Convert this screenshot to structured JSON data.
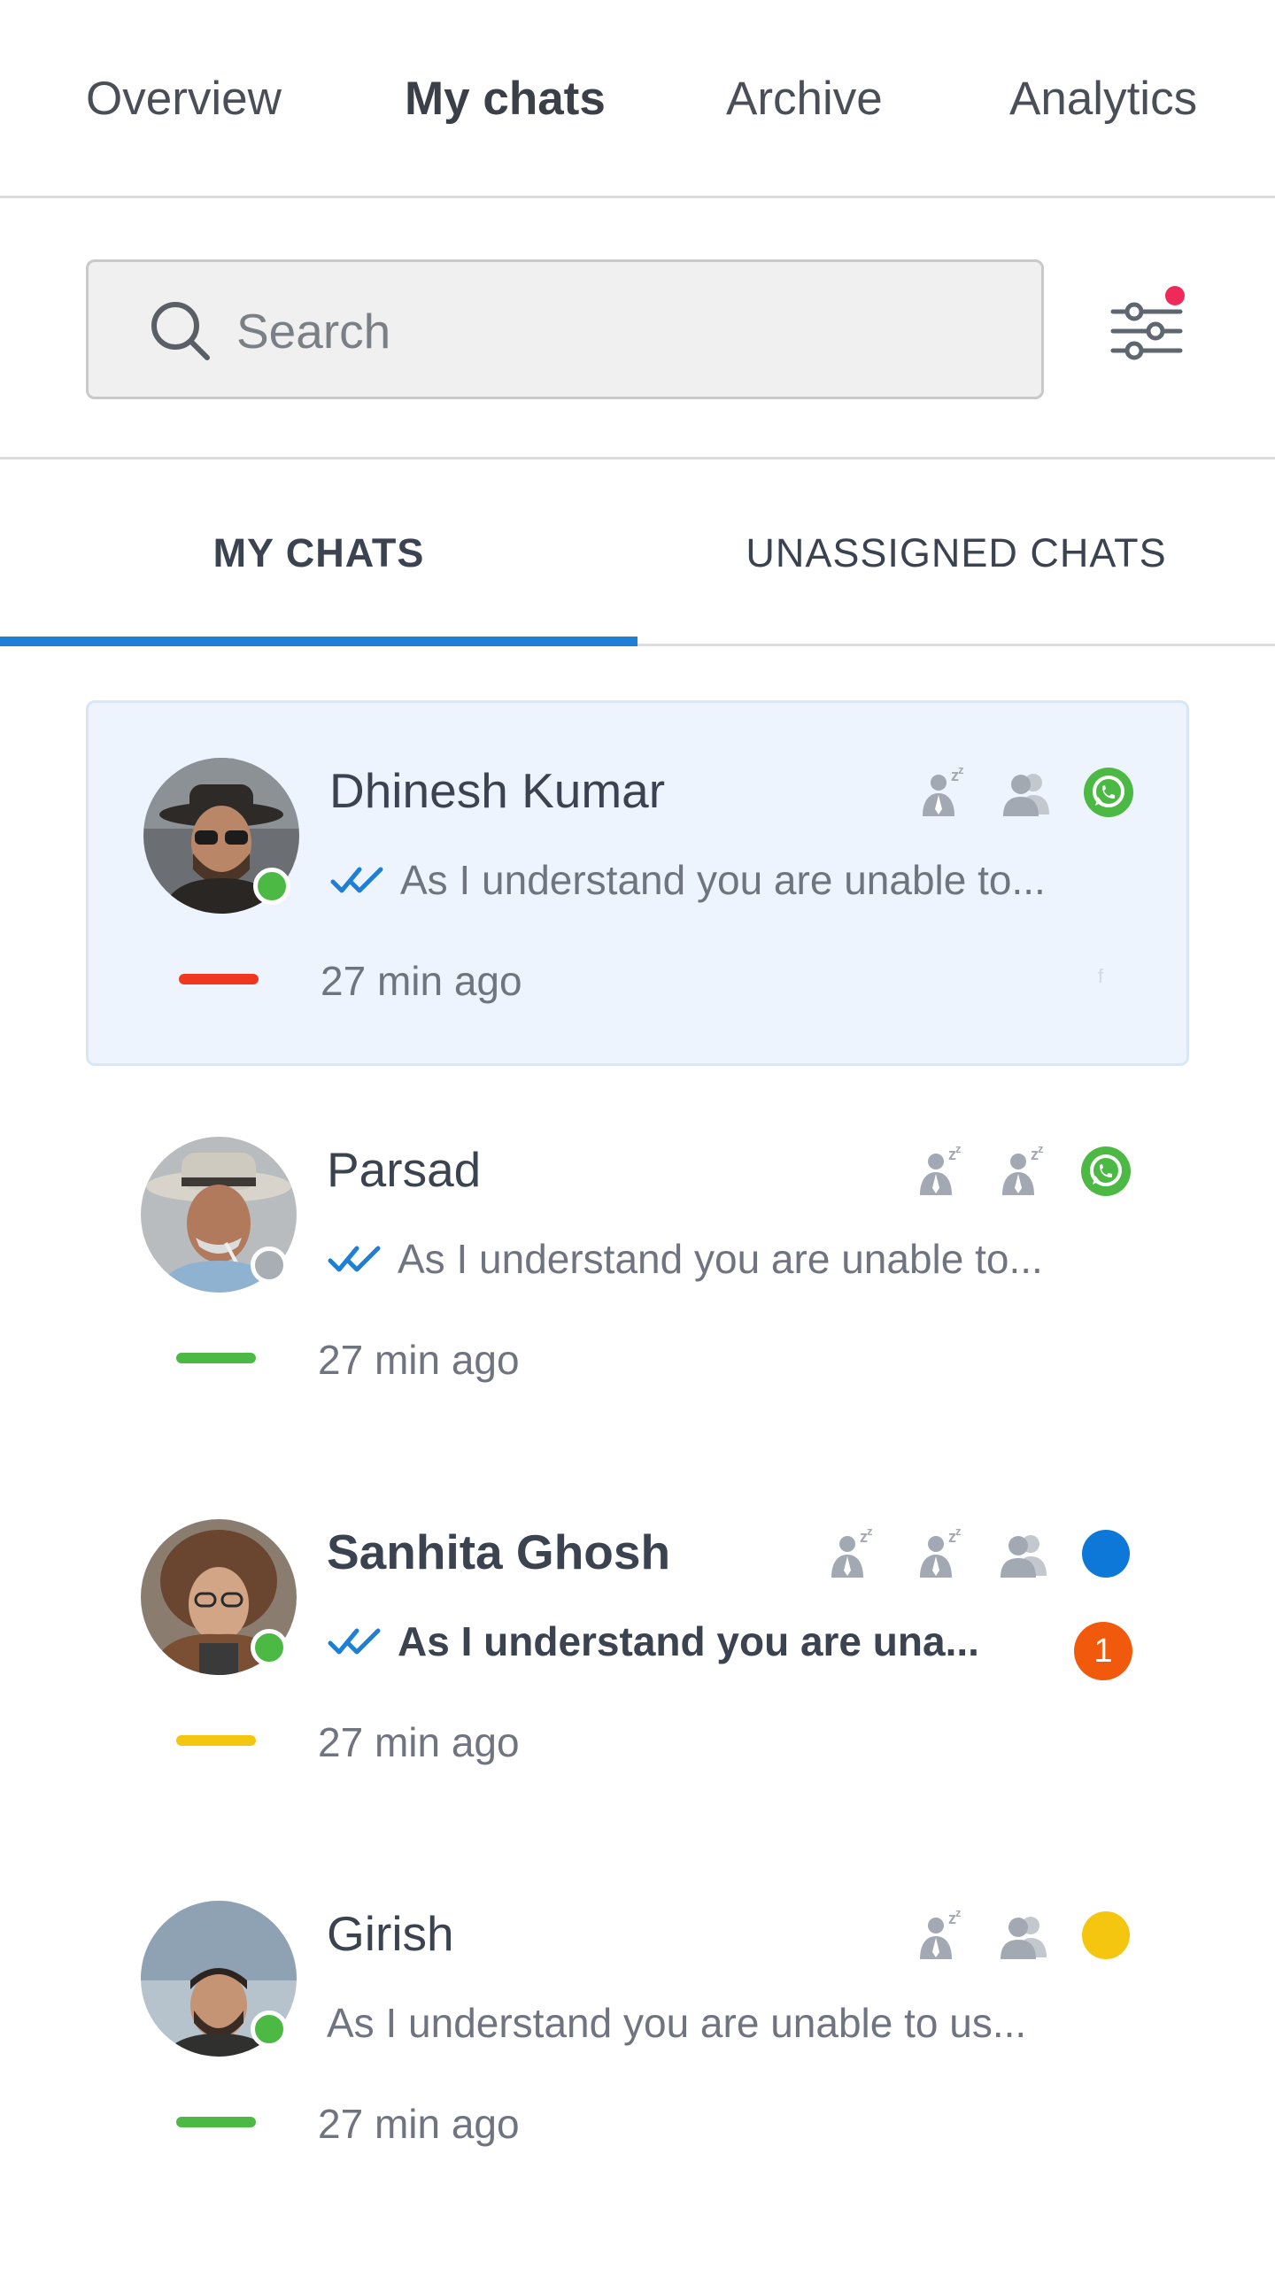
{
  "nav": {
    "items": [
      "Overview",
      "My chats",
      "Archive",
      "Analytics"
    ],
    "active": "My chats"
  },
  "search": {
    "placeholder": "Search"
  },
  "filter": {
    "icon": "sliders-icon",
    "has_notification_dot": true,
    "dot_color": "#ee2a5a"
  },
  "tabs": {
    "items": [
      "MY CHATS",
      "UNASSIGNED CHATS"
    ],
    "active": "MY CHATS",
    "indicator_color": "#1f7fd6"
  },
  "chats": [
    {
      "name": "Dhinesh Kumar",
      "preview": "As I understand you are unable to...",
      "time": "27 min ago",
      "presence": "online",
      "presence_color": "#4cb944",
      "priority_color": "#f0361e",
      "selected": true,
      "bold": false,
      "show_ticks": true,
      "status_icons": [
        "snooze-icon",
        "users-icon",
        "whatsapp-icon"
      ],
      "unread": null
    },
    {
      "name": "Parsad",
      "preview": "As I understand you are unable to...",
      "time": "27 min ago",
      "presence": "offline",
      "presence_color": "#a9adb4",
      "priority_color": "#4cb944",
      "selected": false,
      "bold": false,
      "show_ticks": true,
      "status_icons": [
        "snooze-icon",
        "snooze-icon",
        "whatsapp-icon"
      ],
      "unread": null
    },
    {
      "name": "Sanhita Ghosh",
      "preview": "As I understand you are una...",
      "time": "27 min ago",
      "presence": "online",
      "presence_color": "#4cb944",
      "priority_color": "#f5c60f",
      "selected": false,
      "bold": true,
      "show_ticks": true,
      "status_icons": [
        "snooze-icon",
        "snooze-icon",
        "users-icon",
        "blue-dot-icon"
      ],
      "unread": "1"
    },
    {
      "name": "Girish",
      "preview": "As I understand you are unable to us...",
      "time": "27 min ago",
      "presence": "online",
      "presence_color": "#4cb944",
      "priority_color": "#4cb944",
      "selected": false,
      "bold": false,
      "show_ticks": false,
      "status_icons": [
        "snooze-icon",
        "users-icon",
        "yellow-dot-icon"
      ],
      "unread": null
    }
  ],
  "colors": {
    "accent": "#1f7fd6",
    "whatsapp": "#4cb944",
    "channel_blue": "#0d78d8",
    "channel_yellow": "#f5c60f",
    "unread_badge": "#f15a0c",
    "selected_bg": "#eef4fe"
  }
}
